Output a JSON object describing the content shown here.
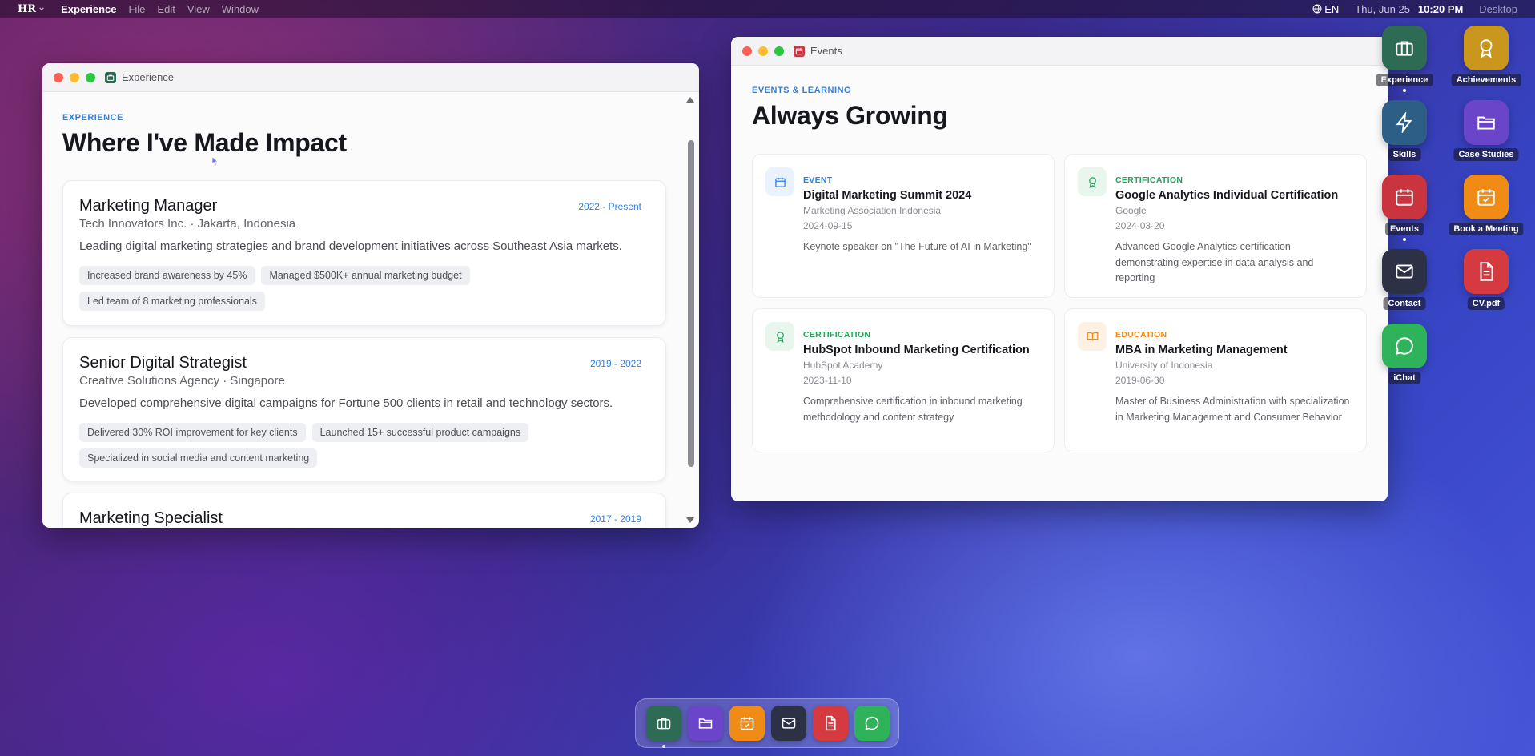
{
  "menubar": {
    "logo": "HR",
    "app_name": "Experience",
    "menus": [
      "File",
      "Edit",
      "View",
      "Window"
    ],
    "language": "EN",
    "date": "Thu, Jun 25",
    "time": "10:20 PM",
    "desktop_label": "Desktop"
  },
  "experience_window": {
    "title": "Experience",
    "kicker": "EXPERIENCE",
    "heading": "Where I've Made Impact",
    "jobs": [
      {
        "role": "Marketing Manager",
        "period": "2022 - Present",
        "company": "Tech Innovators Inc. · Jakarta, Indonesia",
        "description": "Leading digital marketing strategies and brand development initiatives across Southeast Asia markets.",
        "highlights": [
          "Increased brand awareness by 45%",
          "Managed $500K+ annual marketing budget",
          "Led team of 8 marketing professionals"
        ]
      },
      {
        "role": "Senior Digital Strategist",
        "period": "2019 - 2022",
        "company": "Creative Solutions Agency · Singapore",
        "description": "Developed comprehensive digital campaigns for Fortune 500 clients in retail and technology sectors.",
        "highlights": [
          "Delivered 30% ROI improvement for key clients",
          "Launched 15+ successful product campaigns",
          "Specialized in social media and content marketing"
        ]
      },
      {
        "role": "Marketing Specialist",
        "period": "2017 - 2019"
      }
    ]
  },
  "events_window": {
    "title": "Events",
    "kicker": "EVENTS & LEARNING",
    "heading": "Always Growing",
    "cards": [
      {
        "kind": "EVENT",
        "icon": "calendar-icon",
        "color": "#2f7fe3",
        "title": "Digital Marketing Summit 2024",
        "org": "Marketing Association Indonesia",
        "date": "2024-09-15",
        "description": "Keynote speaker on \"The Future of AI in Marketing\""
      },
      {
        "kind": "CERTIFICATION",
        "icon": "award-icon",
        "color": "#22a559",
        "title": "Google Analytics Individual Certification",
        "org": "Google",
        "date": "2024-03-20",
        "description": "Advanced Google Analytics certification demonstrating expertise in data analysis and reporting"
      },
      {
        "kind": "CERTIFICATION",
        "icon": "award-icon",
        "color": "#22a559",
        "title": "HubSpot Inbound Marketing Certification",
        "org": "HubSpot Academy",
        "date": "2023-11-10",
        "description": "Comprehensive certification in inbound marketing methodology and content strategy"
      },
      {
        "kind": "EDUCATION",
        "icon": "book-icon",
        "color": "#f08a12",
        "title": "MBA in Marketing Management",
        "org": "University of Indonesia",
        "date": "2019-06-30",
        "description": "Master of Business Administration with specialization in Marketing Management and Consumer Behavior"
      }
    ]
  },
  "desktop_icons": [
    {
      "label": "Experience",
      "icon": "briefcase-icon",
      "color": "#2e6b55"
    },
    {
      "label": "Achievements",
      "icon": "award-icon",
      "color": "#c9961e"
    },
    {
      "label": "Skills",
      "icon": "lightning-icon",
      "color": "#2d5f86"
    },
    {
      "label": "Case Studies",
      "icon": "folder-icon",
      "color": "#6a44c9"
    },
    {
      "label": "Events",
      "icon": "calendar-icon",
      "color": "#c9343f"
    },
    {
      "label": "Book a Meeting",
      "icon": "calendar-check-icon",
      "color": "#f08c16"
    },
    {
      "label": "Contact",
      "icon": "mail-icon",
      "color": "#2d3145"
    },
    {
      "label": "CV.pdf",
      "icon": "document-icon",
      "color": "#d43a3f"
    },
    {
      "label": "iChat",
      "icon": "chat-icon",
      "color": "#2fb35a"
    }
  ],
  "dock": {
    "items": [
      {
        "icon": "briefcase-icon",
        "color": "#2e6b55"
      },
      {
        "icon": "folder-icon",
        "color": "#6a44c9"
      },
      {
        "icon": "calendar-check-icon",
        "color": "#f08c16"
      },
      {
        "icon": "mail-icon",
        "color": "#2d3145"
      },
      {
        "icon": "document-icon",
        "color": "#d43a3f"
      },
      {
        "icon": "chat-icon",
        "color": "#2fb35a"
      }
    ]
  }
}
